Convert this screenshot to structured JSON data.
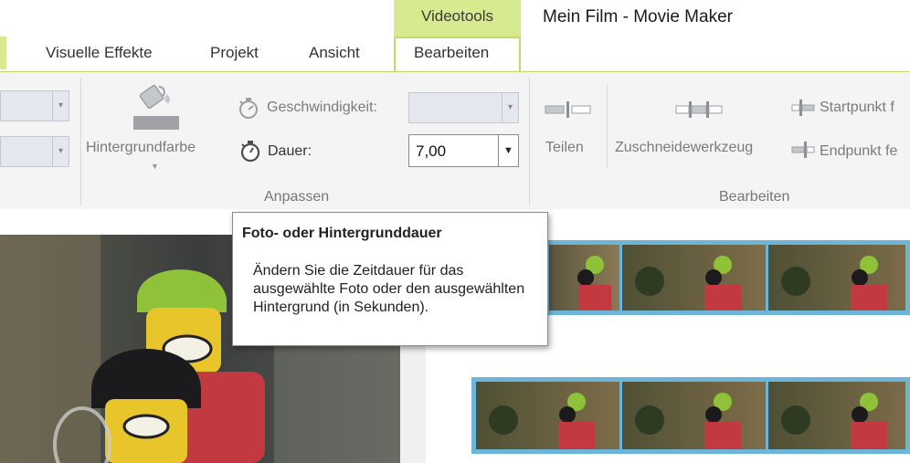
{
  "window": {
    "title": "Mein Film - Movie Maker",
    "context_tab": "Videotools"
  },
  "tabs": [
    {
      "label": "Visuelle Effekte"
    },
    {
      "label": "Projekt"
    },
    {
      "label": "Ansicht"
    },
    {
      "label": "Bearbeiten",
      "active": true
    }
  ],
  "ribbon": {
    "anpassen": {
      "group_label": "Anpassen",
      "hintergrundfarbe_label": "Hintergrundfarbe",
      "geschwindigkeit_label": "Geschwindigkeit:",
      "dauer_label": "Dauer:",
      "dauer_value": "7,00"
    },
    "bearbeiten": {
      "group_label": "Bearbeiten",
      "teilen_label": "Teilen",
      "zuschneide_label": "Zuschneidewerkzeug",
      "startpunkt_label": "Startpunkt f",
      "endpunkt_label": "Endpunkt fe"
    }
  },
  "tooltip": {
    "title": "Foto- oder Hintergrunddauer",
    "body": "Ändern Sie die Zeitdauer für das ausgewählte Foto oder den ausgewählten Hintergrund (in Sekunden)."
  },
  "colors": {
    "accent": "#d7ea8f",
    "frame_border": "#6cb5d8"
  },
  "icons": [
    "paint-bucket-icon",
    "speed-icon",
    "timer-icon",
    "split-icon",
    "trim-icon",
    "set-start-icon",
    "set-end-icon"
  ]
}
